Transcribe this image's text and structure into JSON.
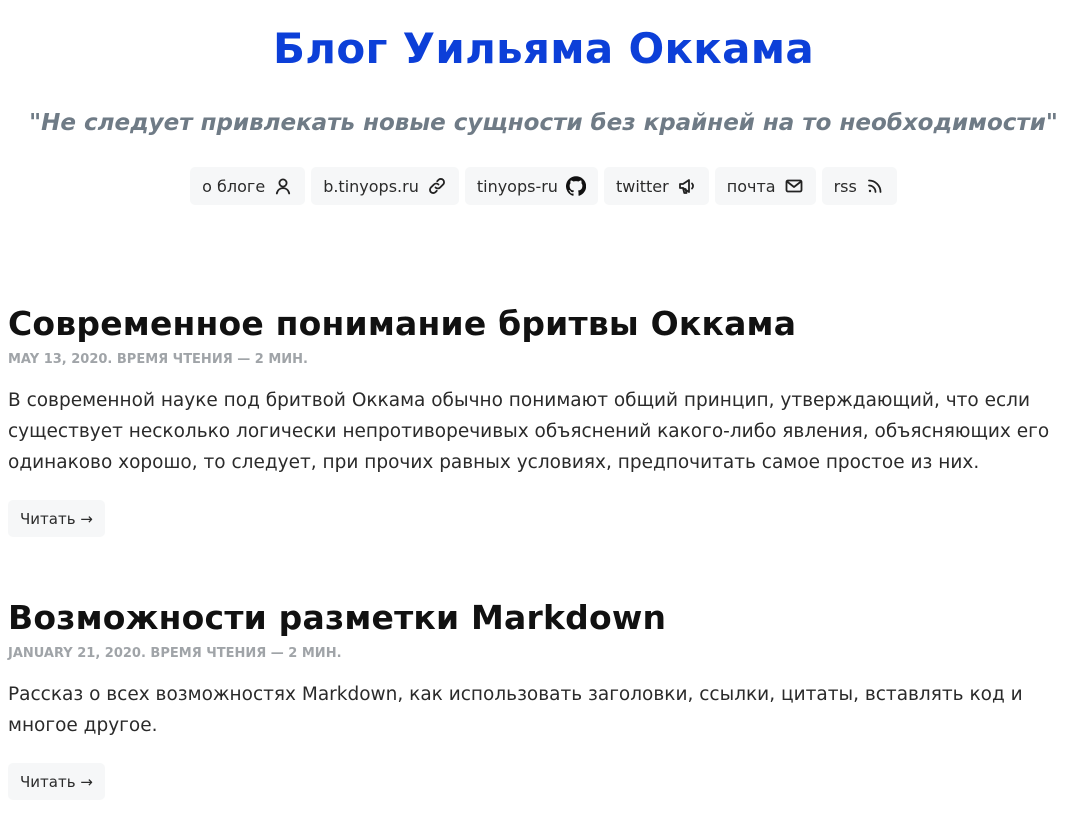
{
  "header": {
    "title": "Блог Уильяма Оккама",
    "tagline": "\"Не следует привлекать новые сущности без крайней на то необходимости\""
  },
  "nav": [
    {
      "label": "о блоге",
      "icon": "user-icon"
    },
    {
      "label": "b.tinyops.ru",
      "icon": "link-icon"
    },
    {
      "label": "tinyops-ru",
      "icon": "github-icon"
    },
    {
      "label": "twitter",
      "icon": "megaphone-icon"
    },
    {
      "label": "почта",
      "icon": "mail-icon"
    },
    {
      "label": "rss",
      "icon": "rss-icon"
    }
  ],
  "posts": [
    {
      "title": "Современное понимание бритвы Оккама",
      "meta": "MAY 13, 2020. ВРЕМЯ ЧТЕНИЯ — 2 МИН.",
      "summary": "В современной науке под бритвой Оккама обычно понимают общий принцип, утверждающий, что если существует несколько логически непротиворечивых объяснений какого-либо явления, объясняющих его одинаково хорошо, то следует, при прочих равных условиях, предпочитать самое простое из них.",
      "button": "Читать →"
    },
    {
      "title": "Возможности разметки Markdown",
      "meta": "JANUARY 21, 2020. ВРЕМЯ ЧТЕНИЯ — 2 МИН.",
      "summary": "Рассказ о всех возможностях Markdown, как использовать заголовки, ссылки, цитаты, вставлять код и многое другое.",
      "button": "Читать →"
    }
  ],
  "colors": {
    "accent": "#0c3fd8",
    "tagline": "#6f7b86",
    "meta": "#a0a4a8",
    "chip_bg": "#f6f7f8"
  }
}
